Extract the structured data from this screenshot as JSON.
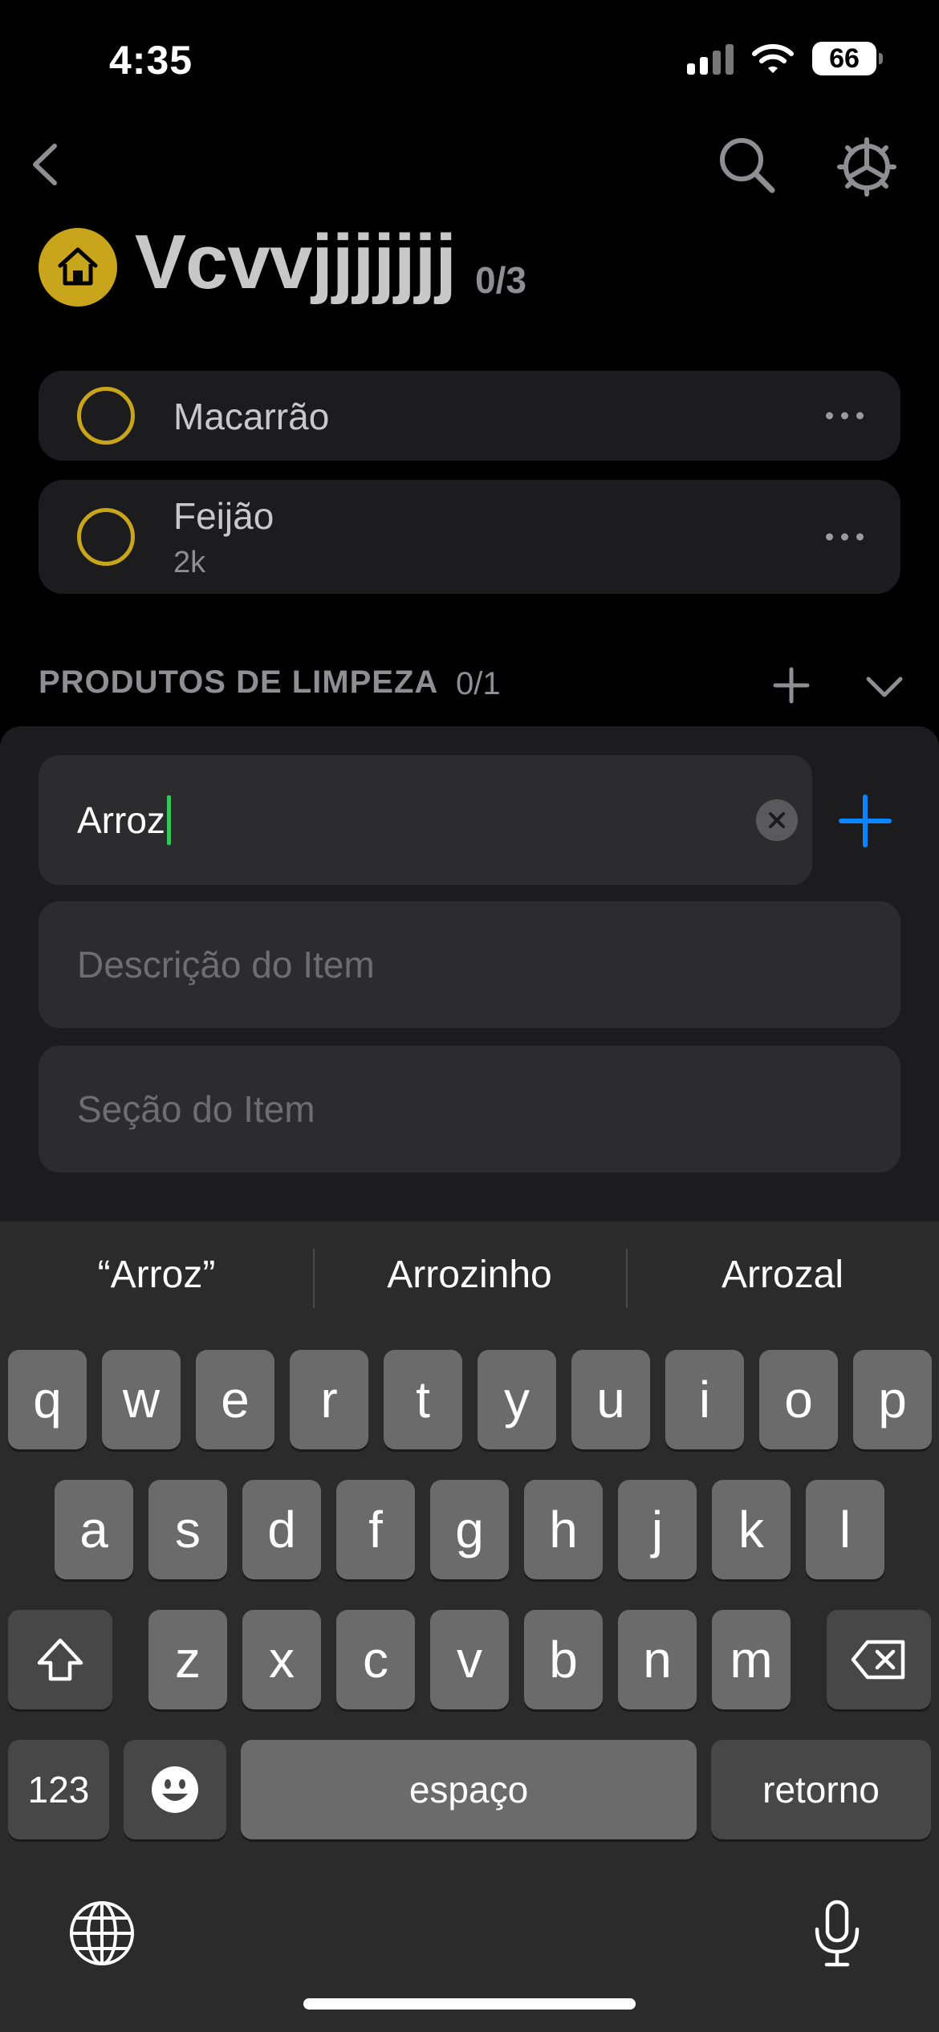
{
  "status_bar": {
    "time": "4:35",
    "battery": "66",
    "icons": [
      "cellular-signal-icon",
      "wifi-icon",
      "battery-icon"
    ]
  },
  "nav": {
    "icons": [
      "back-chevron-icon",
      "search-icon",
      "gear-icon"
    ]
  },
  "list": {
    "icon": "home-icon",
    "title": "Vcvvjjjjjjj",
    "count": "0/3",
    "accent_color": "#c8a51b",
    "items": [
      {
        "name": "Macarrão",
        "description": ""
      },
      {
        "name": "Feijão",
        "description": "2k"
      }
    ]
  },
  "section": {
    "title": "PRODUTOS DE LIMPEZA",
    "count": "0/1",
    "icons": [
      "plus-icon",
      "chevron-down-icon"
    ]
  },
  "add_form": {
    "name_value": "Arroz",
    "description_placeholder": "Descrição do Item",
    "section_placeholder": "Seção do Item",
    "add_color": "#0a84ff",
    "caret_color": "#34c759"
  },
  "keyboard": {
    "suggestions": [
      "“Arroz”",
      "Arrozinho",
      "Arrozal"
    ],
    "row1": [
      "q",
      "w",
      "e",
      "r",
      "t",
      "y",
      "u",
      "i",
      "o",
      "p"
    ],
    "row2": [
      "a",
      "s",
      "d",
      "f",
      "g",
      "h",
      "j",
      "k",
      "l"
    ],
    "row3": [
      "z",
      "x",
      "c",
      "v",
      "b",
      "n",
      "m"
    ],
    "numbers_label": "123",
    "space_label": "espaço",
    "return_label": "retorno",
    "icons": [
      "shift-icon",
      "backspace-icon",
      "emoji-icon",
      "globe-icon",
      "microphone-icon"
    ]
  }
}
